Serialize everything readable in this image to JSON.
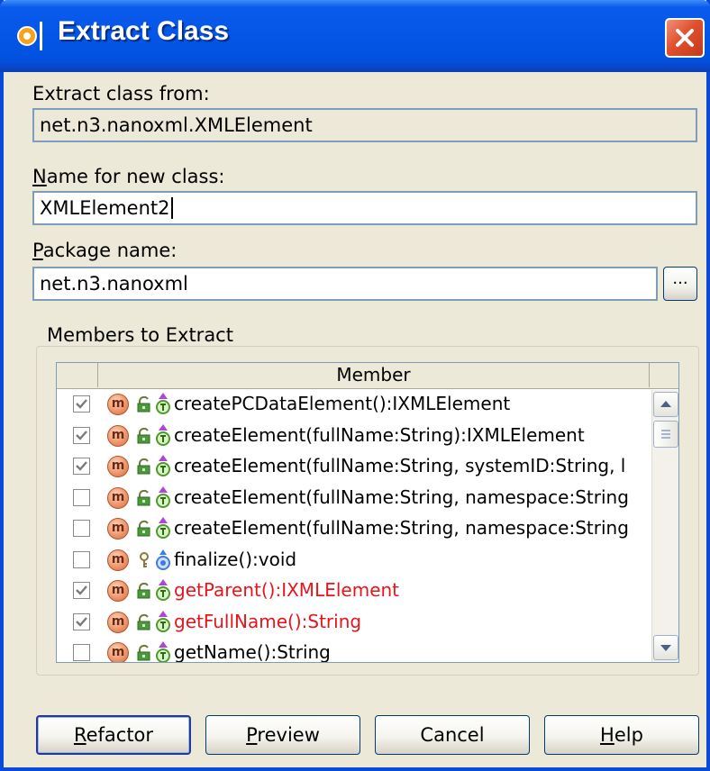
{
  "window": {
    "title": "Extract Class"
  },
  "extract_from": {
    "label": "Extract class from:",
    "value": "net.n3.nanoxml.XMLElement"
  },
  "new_class": {
    "label_mnemonic": "N",
    "label_rest": "ame for new class:",
    "value": "XMLElement2"
  },
  "package": {
    "label_mnemonic": "P",
    "label_rest": "ackage name:",
    "value": "net.n3.nanoxml",
    "browse_label": "..."
  },
  "members": {
    "group_label": "Members to Extract",
    "column_header": "Member",
    "rows": [
      {
        "checked": true,
        "visibility": "public",
        "signature": "createPCDataElement():IXMLElement",
        "highlight": false
      },
      {
        "checked": true,
        "visibility": "public",
        "signature": "createElement(fullName:String):IXMLElement",
        "highlight": false
      },
      {
        "checked": true,
        "visibility": "public",
        "signature": "createElement(fullName:String, systemID:String, l",
        "highlight": false
      },
      {
        "checked": false,
        "visibility": "public",
        "signature": "createElement(fullName:String, namespace:String",
        "highlight": false
      },
      {
        "checked": false,
        "visibility": "public",
        "signature": "createElement(fullName:String, namespace:String",
        "highlight": false
      },
      {
        "checked": false,
        "visibility": "protected",
        "signature": "finalize():void",
        "highlight": false
      },
      {
        "checked": true,
        "visibility": "public",
        "signature": "getParent():IXMLElement",
        "highlight": true
      },
      {
        "checked": true,
        "visibility": "public",
        "signature": "getFullName():String",
        "highlight": true
      },
      {
        "checked": false,
        "visibility": "public",
        "signature": "getName():String",
        "highlight": false
      }
    ],
    "method_icon_letter": "m"
  },
  "buttons": {
    "refactor": {
      "mnemonic": "R",
      "rest": "efactor"
    },
    "preview": {
      "mnemonic": "P",
      "rest": "review"
    },
    "cancel": {
      "label": "Cancel"
    },
    "help": {
      "mnemonic": "H",
      "rest": "elp"
    }
  },
  "colors": {
    "titlebar": "#0456e6",
    "dialog_bg": "#ece9d8",
    "highlight_text": "#e8141b",
    "close_button": "#e1502e"
  }
}
